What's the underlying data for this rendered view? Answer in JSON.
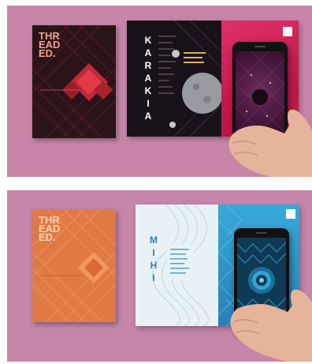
{
  "top_panel": {
    "cover_logo": [
      "THR",
      "EAD",
      "ED."
    ],
    "book_title": "KARAKIA"
  },
  "bottom_panel": {
    "cover_logo": [
      "THR",
      "EAD",
      "ED."
    ],
    "book_title": "MIHI"
  },
  "colors": {
    "background_top": "#c786a8",
    "background_bottom": "#c586aa",
    "cover_dark": "#2a1418",
    "cover_orange": "#e07a45",
    "accent_red": "#d62a4a",
    "accent_blue": "#36a9d8"
  }
}
